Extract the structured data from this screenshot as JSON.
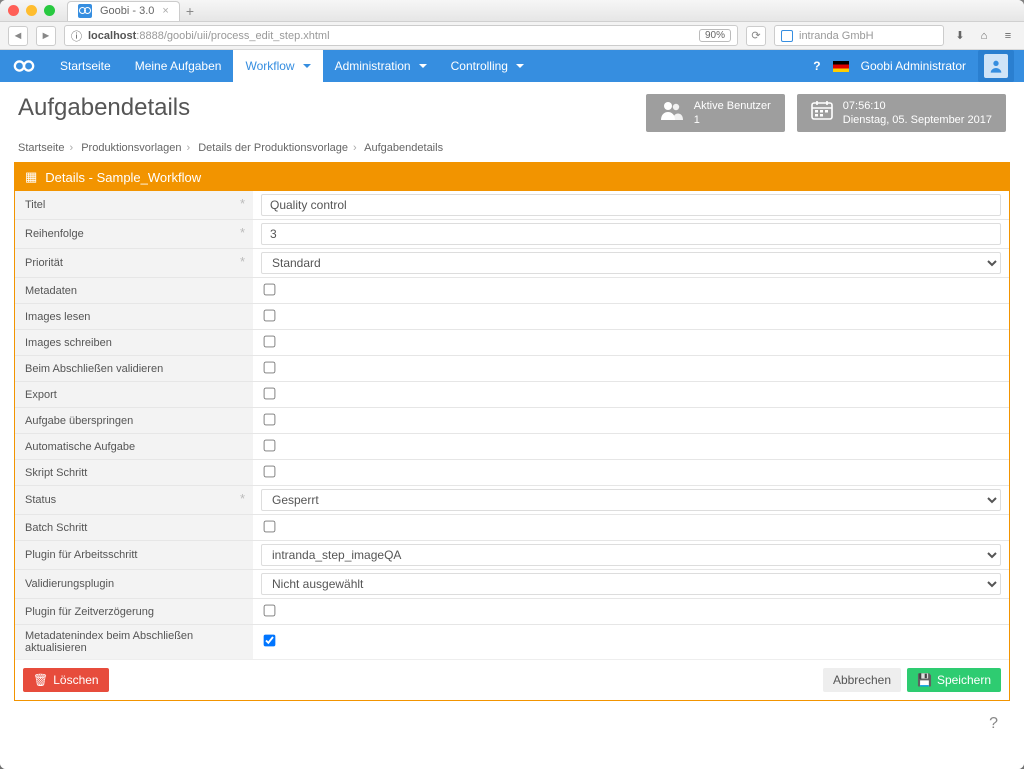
{
  "browser": {
    "tab_title": "Goobi - 3.0",
    "url_host": "localhost",
    "url_path": ":8888/goobi/uii/process_edit_step.xhtml",
    "zoom": "90%",
    "search_placeholder": "intranda GmbH"
  },
  "nav": {
    "items": [
      "Startseite",
      "Meine Aufgaben",
      "Workflow",
      "Administration",
      "Controlling"
    ],
    "user": "Goobi Administrator"
  },
  "header": {
    "title": "Aufgabendetails",
    "active_users_label": "Aktive Benutzer",
    "active_users_count": "1",
    "time": "07:56:10",
    "date": "Dienstag, 05. September 2017"
  },
  "breadcrumb": [
    "Startseite",
    "Produktionsvorlagen",
    "Details der Produktionsvorlage",
    "Aufgabendetails"
  ],
  "panel": {
    "heading": "Details - Sample_Workflow",
    "rows": [
      {
        "label": "Titel",
        "type": "text",
        "value": "Quality control",
        "required": true
      },
      {
        "label": "Reihenfolge",
        "type": "text",
        "value": "3",
        "required": true
      },
      {
        "label": "Priorität",
        "type": "select",
        "value": "Standard",
        "required": true
      },
      {
        "label": "Metadaten",
        "type": "checkbox",
        "checked": false
      },
      {
        "label": "Images lesen",
        "type": "checkbox",
        "checked": false
      },
      {
        "label": "Images schreiben",
        "type": "checkbox",
        "checked": false
      },
      {
        "label": "Beim Abschließen validieren",
        "type": "checkbox",
        "checked": false
      },
      {
        "label": "Export",
        "type": "checkbox",
        "checked": false
      },
      {
        "label": "Aufgabe überspringen",
        "type": "checkbox",
        "checked": false
      },
      {
        "label": "Automatische Aufgabe",
        "type": "checkbox",
        "checked": false
      },
      {
        "label": "Skript Schritt",
        "type": "checkbox",
        "checked": false
      },
      {
        "label": "Status",
        "type": "select",
        "value": "Gesperrt",
        "required": true
      },
      {
        "label": "Batch Schritt",
        "type": "checkbox",
        "checked": false
      },
      {
        "label": "Plugin für Arbeitsschritt",
        "type": "select",
        "value": "intranda_step_imageQA"
      },
      {
        "label": "Validierungsplugin",
        "type": "select",
        "value": "Nicht ausgewählt"
      },
      {
        "label": "Plugin für Zeitverzögerung",
        "type": "checkbox",
        "checked": false
      },
      {
        "label": "Metadatenindex beim Abschließen aktualisieren",
        "type": "checkbox",
        "checked": true
      }
    ],
    "buttons": {
      "delete": "Löschen",
      "cancel": "Abbrechen",
      "save": "Speichern"
    }
  }
}
